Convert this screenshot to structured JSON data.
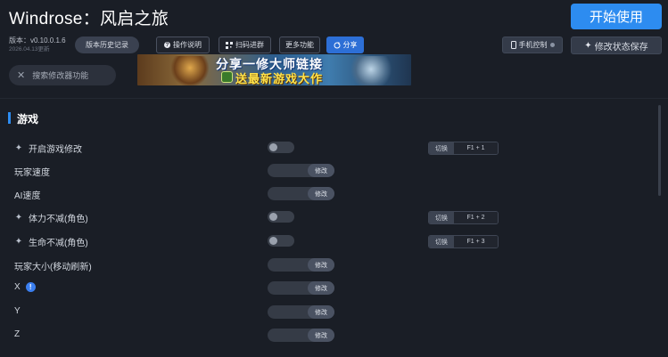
{
  "header": {
    "title": "Windrose：风启之旅",
    "start_label": "开始使用",
    "version": "版本：v0.10.0.1.6",
    "update_date": "2026.04.13更新",
    "history_label": "版本历史记录",
    "guide_label": "操作说明",
    "scan_label": "扫码进群",
    "more_label": "更多功能",
    "share_label": "分享",
    "phone_label": "手机控制",
    "save_label": "修改状态保存"
  },
  "search": {
    "placeholder": "搜索修改器功能"
  },
  "banner": {
    "line1": "分享一修大师链接",
    "line2": "送最新游戏大作"
  },
  "section": {
    "title": "游戏"
  },
  "rows": [
    {
      "label": "开启游戏修改",
      "control": "toggle",
      "on": false,
      "hotkey_toggle": "切换",
      "hotkey": "F1 + 1",
      "icon": "sparkle-icon"
    },
    {
      "label": "玩家速度",
      "control": "slider",
      "button": "修改"
    },
    {
      "label": "AI速度",
      "control": "slider",
      "button": "修改"
    },
    {
      "label": "体力不减(角色)",
      "control": "toggle",
      "on": false,
      "hotkey_toggle": "切换",
      "hotkey": "F1 + 2",
      "icon": "sparkle-icon"
    },
    {
      "label": "生命不减(角色)",
      "control": "toggle",
      "on": false,
      "hotkey_toggle": "切换",
      "hotkey": "F1 + 3",
      "icon": "sparkle-icon"
    },
    {
      "label": "玩家大小(移动刷新)",
      "control": "slider",
      "button": "修改"
    },
    {
      "label": "X",
      "control": "slider",
      "button": "修改",
      "info_icon": "!"
    },
    {
      "label": "Y",
      "control": "slider",
      "button": "修改"
    },
    {
      "label": "Z",
      "control": "slider",
      "button": "修改"
    }
  ],
  "colors": {
    "accent": "#2d8cf0",
    "background": "#1a1e26"
  }
}
